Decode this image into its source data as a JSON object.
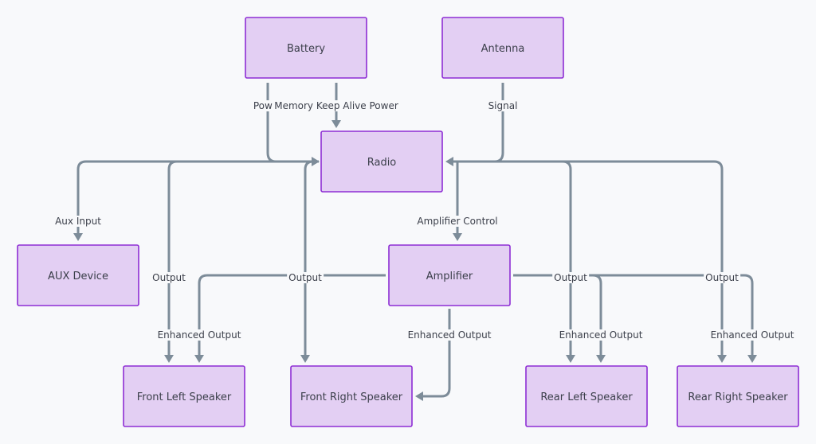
{
  "diagram": {
    "type": "flowchart",
    "nodes": [
      {
        "id": "battery",
        "label": "Battery"
      },
      {
        "id": "antenna",
        "label": "Antenna"
      },
      {
        "id": "radio",
        "label": "Radio"
      },
      {
        "id": "aux",
        "label": "AUX Device"
      },
      {
        "id": "amplifier",
        "label": "Amplifier"
      },
      {
        "id": "fl",
        "label": "Front Left Speaker"
      },
      {
        "id": "fr",
        "label": "Front Right Speaker"
      },
      {
        "id": "rl",
        "label": "Rear Left Speaker"
      },
      {
        "id": "rr",
        "label": "Rear Right Speaker"
      }
    ],
    "edges": [
      {
        "from": "battery",
        "to": "radio",
        "label": "Power"
      },
      {
        "from": "battery",
        "to": "radio",
        "label": "Memory Keep Alive Power"
      },
      {
        "from": "antenna",
        "to": "radio",
        "label": "Signal"
      },
      {
        "from": "radio",
        "to": "aux",
        "label": "Aux Input"
      },
      {
        "from": "radio",
        "to": "amplifier",
        "label": "Amplifier Control"
      },
      {
        "from": "radio",
        "to": "fl",
        "label": "Output"
      },
      {
        "from": "radio",
        "to": "fr",
        "label": "Output"
      },
      {
        "from": "radio",
        "to": "rl",
        "label": "Output"
      },
      {
        "from": "radio",
        "to": "rr",
        "label": "Output"
      },
      {
        "from": "amplifier",
        "to": "fl",
        "label": "Enhanced Output"
      },
      {
        "from": "amplifier",
        "to": "fr",
        "label": "Enhanced Output"
      },
      {
        "from": "amplifier",
        "to": "rl",
        "label": "Enhanced Output"
      },
      {
        "from": "amplifier",
        "to": "rr",
        "label": "Enhanced Output"
      }
    ]
  }
}
